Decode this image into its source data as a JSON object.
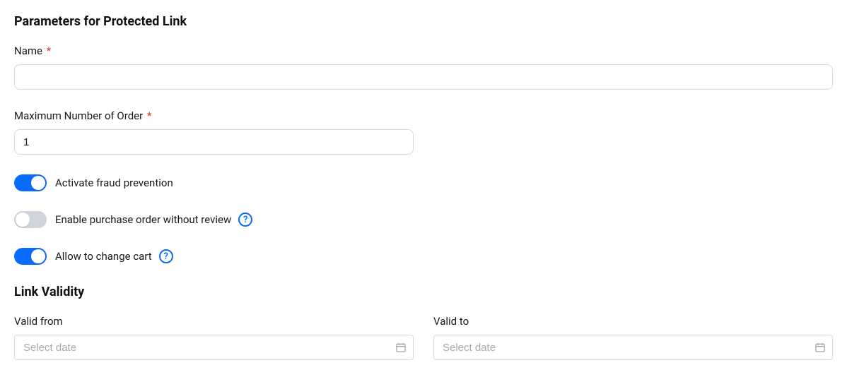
{
  "section1": {
    "title": "Parameters for Protected Link",
    "name_label": "Name",
    "name_value": "",
    "max_order_label": "Maximum Number of Order",
    "max_order_value": "1"
  },
  "toggles": {
    "fraud": {
      "label": "Activate fraud prevention",
      "on": true
    },
    "purchase_no_review": {
      "label": "Enable purchase order without review",
      "on": false
    },
    "allow_change_cart": {
      "label": "Allow to change cart",
      "on": true
    }
  },
  "section2": {
    "title": "Link Validity",
    "from_label": "Valid from",
    "to_label": "Valid to",
    "date_placeholder": "Select date"
  },
  "help_glyph": "?"
}
